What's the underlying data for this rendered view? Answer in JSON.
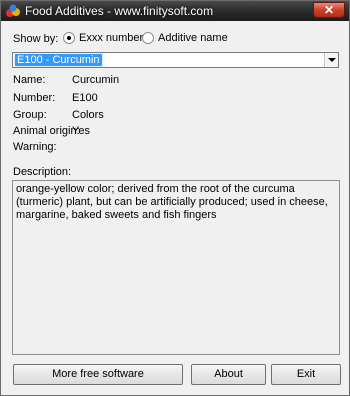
{
  "window": {
    "title": "Food Additives - www.finitysoft.com",
    "close_label": "✕"
  },
  "show_by": {
    "label": "Show by:",
    "options": [
      {
        "label": "Exxx number",
        "checked": true
      },
      {
        "label": "Additive name",
        "checked": false
      }
    ]
  },
  "selector": {
    "value": "E100 - Curcumin"
  },
  "fields": [
    {
      "label": "Name:",
      "value": "Curcumin"
    },
    {
      "label": "Number:",
      "value": "E100"
    },
    {
      "label": "Group:",
      "value": "Colors"
    },
    {
      "label": "Animal origin:",
      "value": "Yes"
    },
    {
      "label": "Warning:",
      "value": ""
    }
  ],
  "description": {
    "label": "Description:",
    "text": "orange-yellow color; derived from the root of the curcuma (turmeric) plant, but can be artificially produced; used in cheese, margarine, baked sweets and fish fingers"
  },
  "buttons": {
    "more": "More free software",
    "about": "About",
    "exit": "Exit"
  }
}
